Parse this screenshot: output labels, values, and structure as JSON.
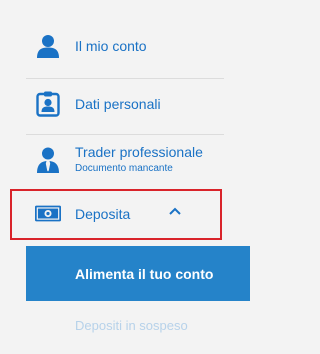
{
  "menu": {
    "items": [
      {
        "label": "Il mio conto",
        "icon": "user-icon"
      },
      {
        "label": "Dati personali",
        "icon": "id-badge-icon"
      },
      {
        "label": "Trader professionale",
        "sublabel": "Documento mancante",
        "icon": "trader-icon"
      },
      {
        "label": "Deposita",
        "icon": "banknote-icon",
        "expanded": true
      }
    ],
    "submenu": [
      {
        "label": "Alimenta il tuo conto",
        "active": true
      },
      {
        "label": "Depositi in sospeso",
        "active": false
      }
    ]
  },
  "colors": {
    "accent": "#1a72c5",
    "active_bg": "#2583c9",
    "highlight_border": "#d9232a",
    "muted": "#b7d2ea"
  }
}
